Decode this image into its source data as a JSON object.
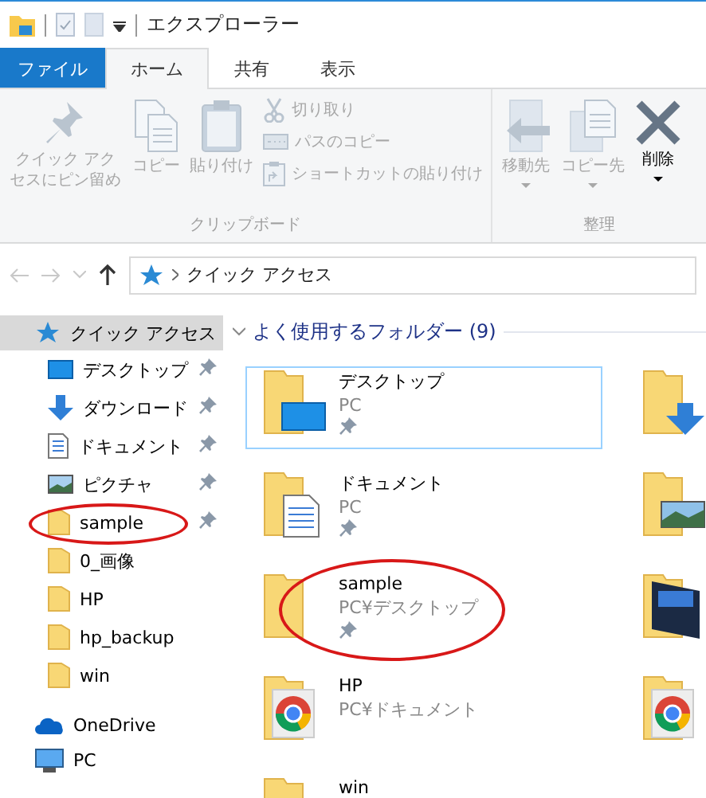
{
  "title_bar": {
    "title": "エクスプローラー"
  },
  "tabs": [
    {
      "label": "ファイル",
      "kind": "file",
      "selected": false
    },
    {
      "label": "ホーム",
      "kind": "tab",
      "selected": true
    },
    {
      "label": "共有",
      "kind": "tab",
      "selected": false
    },
    {
      "label": "表示",
      "kind": "tab",
      "selected": false
    }
  ],
  "ribbon": {
    "groups": [
      {
        "label": "クリップボード",
        "buttons": [
          {
            "label": "クイック アクセスにピン留め",
            "kind": "large",
            "disabled": true
          },
          {
            "label": "コピー",
            "kind": "large",
            "disabled": true
          },
          {
            "label": "貼り付け",
            "kind": "large",
            "disabled": true
          },
          {
            "label": "切り取り",
            "kind": "small",
            "disabled": true
          },
          {
            "label": "パスのコピー",
            "kind": "small",
            "disabled": true
          },
          {
            "label": "ショートカットの貼り付け",
            "kind": "small",
            "disabled": true
          }
        ]
      },
      {
        "label": "整理",
        "buttons": [
          {
            "label": "移動先",
            "kind": "dropdown",
            "disabled": true
          },
          {
            "label": "コピー先",
            "kind": "dropdown",
            "disabled": true
          },
          {
            "label": "削除",
            "kind": "dropdown",
            "disabled": false
          }
        ]
      }
    ]
  },
  "address_bar": {
    "path": "クイック アクセス"
  },
  "nav_pane": {
    "items": [
      {
        "label": "クイック アクセス",
        "kind": "root",
        "selected": true,
        "pinned": false
      },
      {
        "label": "デスクトップ",
        "kind": "child",
        "selected": false,
        "pinned": true
      },
      {
        "label": "ダウンロード",
        "kind": "child",
        "selected": false,
        "pinned": true
      },
      {
        "label": "ドキュメント",
        "kind": "child",
        "selected": false,
        "pinned": true
      },
      {
        "label": "ピクチャ",
        "kind": "child",
        "selected": false,
        "pinned": true
      },
      {
        "label": "sample",
        "kind": "child",
        "selected": false,
        "pinned": true
      },
      {
        "label": "0_画像",
        "kind": "child",
        "selected": false,
        "pinned": false
      },
      {
        "label": "HP",
        "kind": "child",
        "selected": false,
        "pinned": false
      },
      {
        "label": "hp_backup",
        "kind": "child",
        "selected": false,
        "pinned": false
      },
      {
        "label": "win",
        "kind": "child",
        "selected": false,
        "pinned": false
      },
      {
        "label": "OneDrive",
        "kind": "root",
        "selected": false,
        "pinned": false
      },
      {
        "label": "PC",
        "kind": "root",
        "selected": false,
        "pinned": false
      }
    ]
  },
  "frequent_folders": {
    "heading": "よく使用するフォルダー (9)",
    "expanded": true,
    "tiles": [
      {
        "name": "デスクトップ",
        "location": "PC",
        "pinned": true,
        "selected": true
      },
      {
        "selected": false
      },
      {
        "name": "ドキュメント",
        "location": "PC",
        "pinned": true,
        "selected": false
      },
      {
        "selected": false
      },
      {
        "name": "sample",
        "location": "PC¥デスクトップ",
        "pinned": true,
        "selected": false
      },
      {
        "selected": false
      },
      {
        "name": "HP",
        "location": "PC¥ドキュメント",
        "pinned": false,
        "selected": false
      },
      {
        "selected": false
      },
      {
        "name": "win",
        "pinned": false,
        "selected": false
      }
    ]
  }
}
